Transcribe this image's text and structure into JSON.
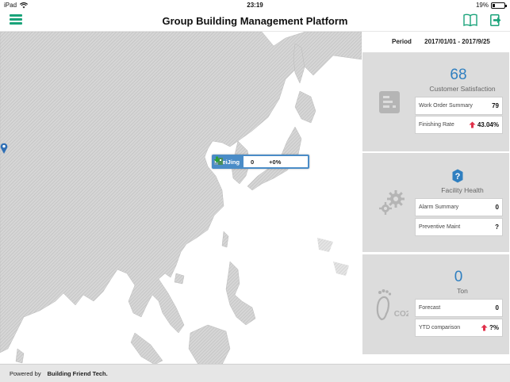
{
  "status_bar": {
    "device": "iPad",
    "time": "23:19",
    "battery": "19%",
    "battery_level": 0.19
  },
  "header": {
    "title": "Group Building Management Platform"
  },
  "period": {
    "label": "Period",
    "range": "2017/01/01 - 2017/9/25"
  },
  "map": {
    "popup": {
      "city": "BeiJing",
      "count": "0",
      "change": "+0%"
    }
  },
  "panels": {
    "satisfaction": {
      "value": "68",
      "label": "Customer Satisfaction",
      "rows": [
        {
          "label": "Work Order Summary",
          "value": "79"
        },
        {
          "label": "Finishing Rate",
          "value": "43.04%"
        }
      ]
    },
    "facility": {
      "value": "?",
      "label": "Facility Health",
      "rows": [
        {
          "label": "Alarm Summary",
          "value": "0"
        },
        {
          "label": "Preventive Maint",
          "value": "?"
        }
      ]
    },
    "carbon": {
      "value": "0",
      "label": "Ton",
      "icon_text": "CO2",
      "rows": [
        {
          "label": "Forecast",
          "value": "0"
        },
        {
          "label": "YTD comparison",
          "value": "?%"
        }
      ]
    }
  },
  "footer": {
    "powered_by": "Powered by",
    "company": "Building Friend Tech."
  },
  "colors": {
    "accent_green": "#1aa37a",
    "value_blue": "#2f7fc0",
    "up_red": "#e0304a",
    "down_green": "#2aa03a",
    "popup_blue": "#4a8cc7"
  }
}
